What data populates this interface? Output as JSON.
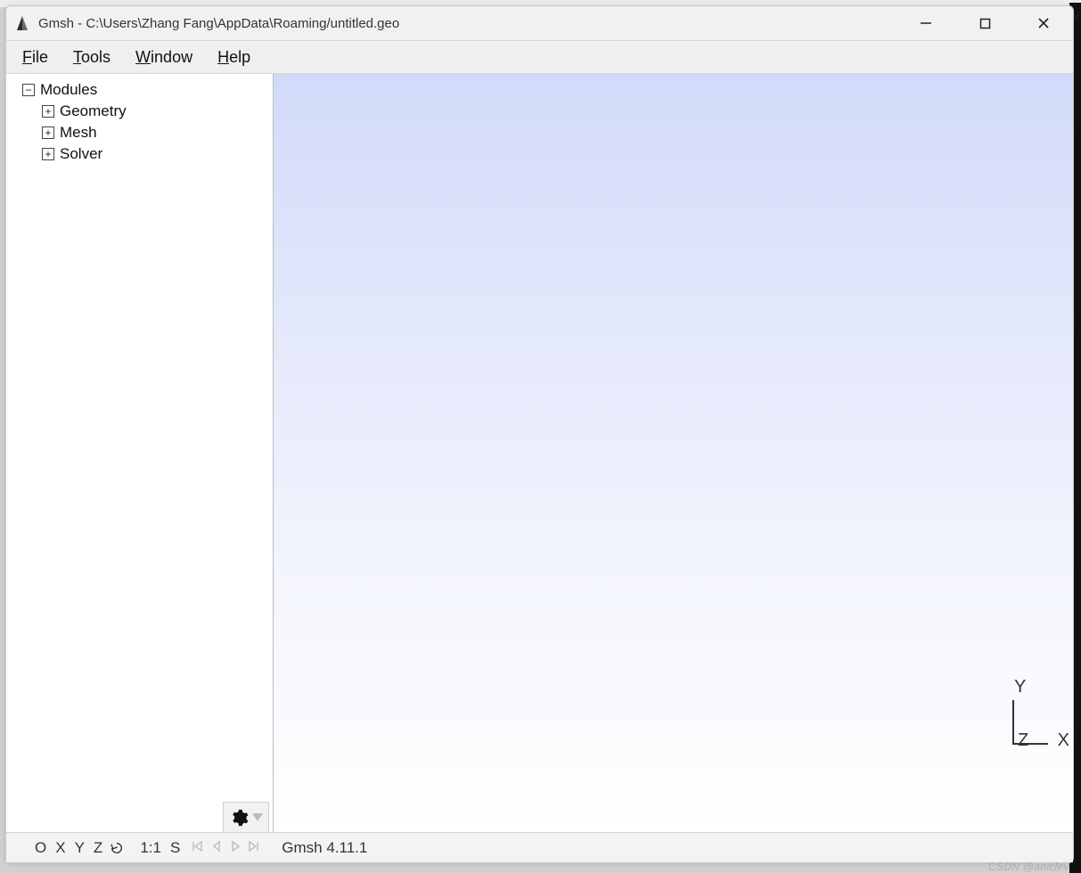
{
  "titlebar": {
    "title": "Gmsh - C:\\Users\\Zhang Fang\\AppData\\Roaming/untitled.geo"
  },
  "menu": {
    "file": "File",
    "tools": "Tools",
    "window": "Window",
    "help": "Help"
  },
  "tree": {
    "root": "Modules",
    "children": [
      {
        "label": "Geometry"
      },
      {
        "label": "Mesh"
      },
      {
        "label": "Solver"
      }
    ]
  },
  "axes": {
    "x": "X",
    "y": "Y",
    "z": "Z"
  },
  "statusbar": {
    "views": [
      "O",
      "X",
      "Y",
      "Z"
    ],
    "scale": "1:1",
    "mode": "S",
    "message": "Gmsh 4.11.1"
  },
  "watermark": "CSDN @aniclever"
}
